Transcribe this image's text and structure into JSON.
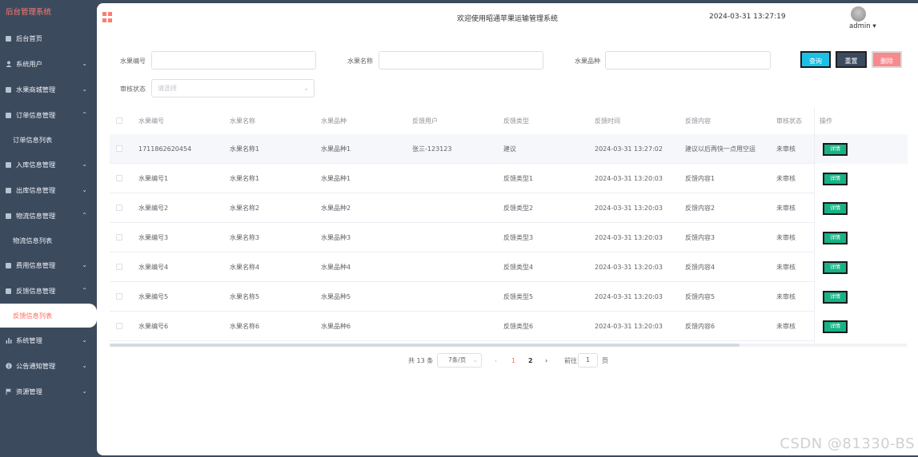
{
  "sidebar": {
    "brand": "后台管理系统",
    "items": [
      {
        "label": "后台首页",
        "icon": "monitor-icon",
        "caret": ""
      },
      {
        "label": "系统用户",
        "icon": "user-icon",
        "caret": "⌄"
      },
      {
        "label": "水果商城管理",
        "icon": "checkbox-icon",
        "caret": "⌄"
      },
      {
        "label": "订单信息管理",
        "icon": "checkbox-icon",
        "caret": "⌃"
      },
      {
        "label": "订单信息列表",
        "sub": true
      },
      {
        "label": "入库信息管理",
        "icon": "checkbox-icon",
        "caret": "⌄"
      },
      {
        "label": "出库信息管理",
        "icon": "checkbox-icon",
        "caret": "⌄"
      },
      {
        "label": "物流信息管理",
        "icon": "checkbox-icon",
        "caret": "⌃"
      },
      {
        "label": "物流信息列表",
        "sub": true
      },
      {
        "label": "费用信息管理",
        "icon": "checkbox-icon",
        "caret": "⌄"
      },
      {
        "label": "反馈信息管理",
        "icon": "checkbox-icon",
        "caret": "⌃"
      },
      {
        "label": "反馈信息列表",
        "sub": true,
        "active": true
      },
      {
        "label": "系统管理",
        "icon": "bar-chart-icon",
        "caret": "⌄"
      },
      {
        "label": "公告通知管理",
        "icon": "info-icon",
        "caret": "⌄"
      },
      {
        "label": "资源管理",
        "icon": "flag-icon",
        "caret": "⌄"
      }
    ]
  },
  "header": {
    "title": "欢迎使用昭通苹果运输管理系统",
    "datetime": "2024-03-31 13:27:19",
    "user": "admin ▾"
  },
  "search": {
    "fruit_no_label": "水果编号",
    "fruit_name_label": "水果名称",
    "fruit_variety_label": "水果品种",
    "review_status_label": "审核状态",
    "review_status_placeholder": "请选择",
    "query": "查询",
    "reset": "重置",
    "delete": "删除"
  },
  "table": {
    "headers": [
      "水果编号",
      "水果名称",
      "水果品种",
      "反馈用户",
      "反馈类型",
      "反馈时间",
      "反馈内容",
      "审核状态",
      "操作"
    ],
    "detail_label": "详情",
    "rows": [
      [
        "1711862620454",
        "水果名称1",
        "水果品种1",
        "张三-123123",
        "建议",
        "2024-03-31 13:27:02",
        "建议以后再快一点用空运",
        "未审核"
      ],
      [
        "水果编号1",
        "水果名称1",
        "水果品种1",
        "",
        "反馈类型1",
        "2024-03-31 13:20:03",
        "反馈内容1",
        "未审核"
      ],
      [
        "水果编号2",
        "水果名称2",
        "水果品种2",
        "",
        "反馈类型2",
        "2024-03-31 13:20:03",
        "反馈内容2",
        "未审核"
      ],
      [
        "水果编号3",
        "水果名称3",
        "水果品种3",
        "",
        "反馈类型3",
        "2024-03-31 13:20:03",
        "反馈内容3",
        "未审核"
      ],
      [
        "水果编号4",
        "水果名称4",
        "水果品种4",
        "",
        "反馈类型4",
        "2024-03-31 13:20:03",
        "反馈内容4",
        "未审核"
      ],
      [
        "水果编号5",
        "水果名称5",
        "水果品种5",
        "",
        "反馈类型5",
        "2024-03-31 13:20:03",
        "反馈内容5",
        "未审核"
      ],
      [
        "水果编号6",
        "水果名称6",
        "水果品种6",
        "",
        "反馈类型6",
        "2024-03-31 13:20:03",
        "反馈内容6",
        "未审核"
      ]
    ]
  },
  "pagination": {
    "total": "共 13 条",
    "page_size": "7条/页",
    "prev": "‹",
    "pages": [
      "1",
      "2"
    ],
    "current": "1",
    "next": "›",
    "goto_label": "前往",
    "goto_value": "1",
    "page_unit": "页"
  },
  "watermark": "CSDN @81330-BS",
  "colors": {
    "sidebar_bg": "#3c4a5e",
    "accent": "#ff6b5e",
    "query_btn": "#1dc0e5",
    "delete_btn": "#f78a8e",
    "detail_btn": "#16b386"
  }
}
